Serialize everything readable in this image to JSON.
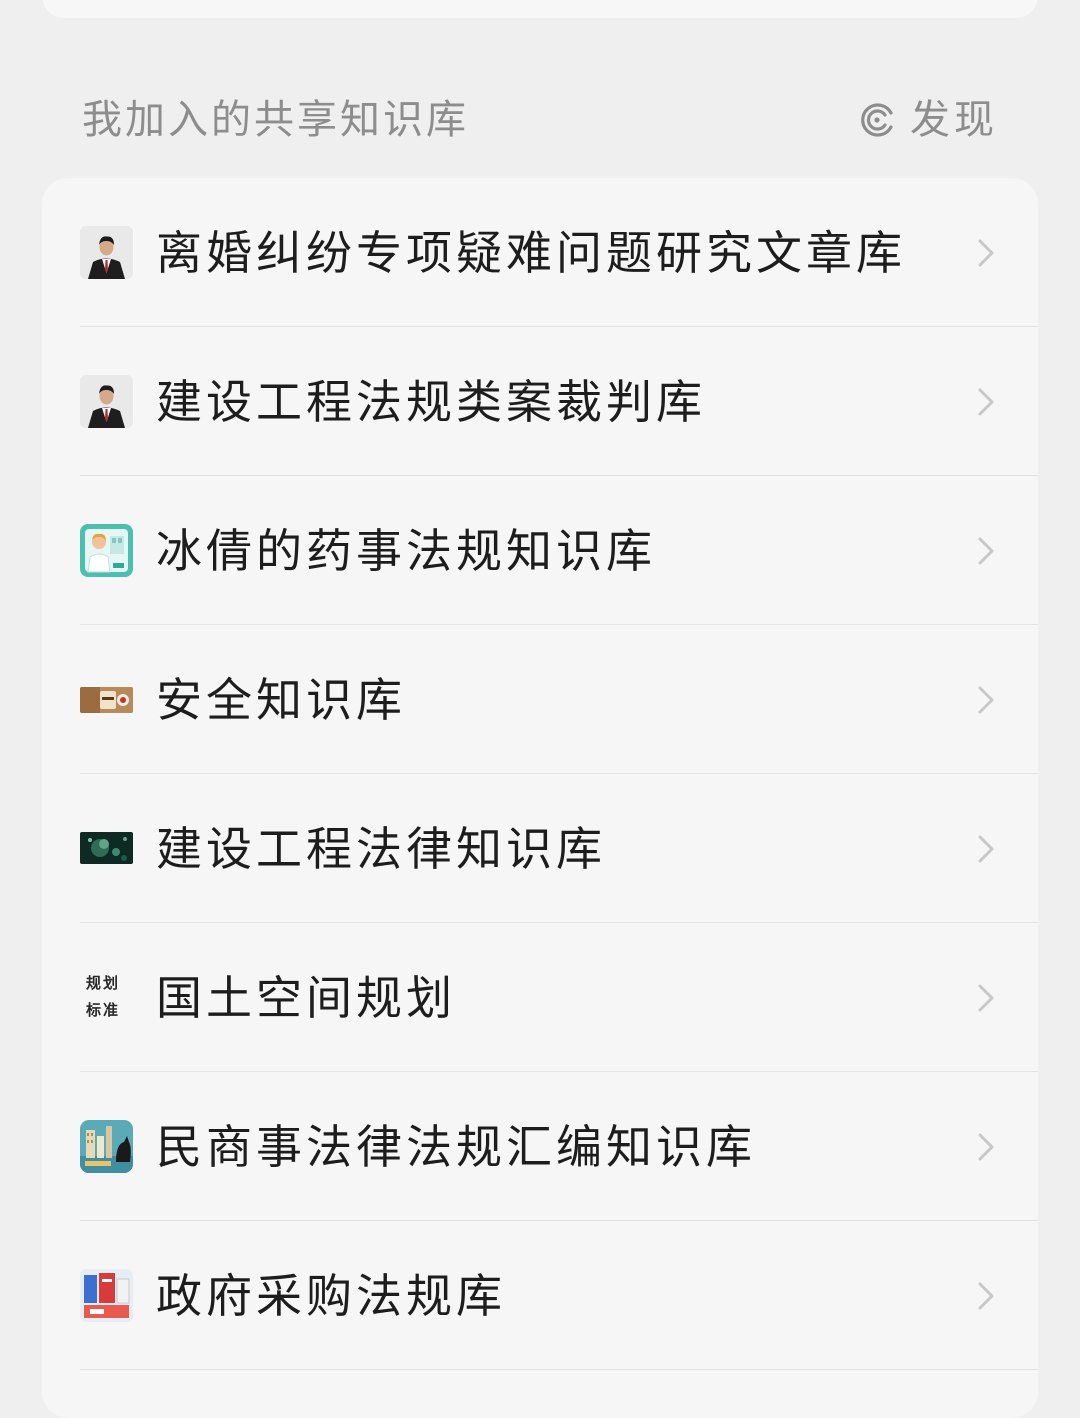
{
  "section": {
    "title": "我加入的共享知识库",
    "discover_label": "发现"
  },
  "items": [
    {
      "label": "离婚纠纷专项疑难问题研究文章库",
      "icon": "lawyer-avatar-icon"
    },
    {
      "label": "建设工程法规类案裁判库",
      "icon": "lawyer-avatar-icon"
    },
    {
      "label": "冰倩的药事法规知识库",
      "icon": "pharmacist-icon"
    },
    {
      "label": "安全知识库",
      "icon": "safety-photo-icon"
    },
    {
      "label": "建设工程法律知识库",
      "icon": "green-texture-icon"
    },
    {
      "label": "国土空间规划",
      "icon": "calligraphy-icon"
    },
    {
      "label": "民商事法律法规汇编知识库",
      "icon": "city-scene-icon"
    },
    {
      "label": "政府采购法规库",
      "icon": "office-supplies-icon"
    }
  ],
  "icon_text": {
    "calligraphy_line1": "规划",
    "calligraphy_line2": "标准"
  },
  "colors": {
    "page_background": "#efefef",
    "card_background": "#f6f6f6",
    "primary_text": "#1d1d1d",
    "secondary_text": "#8d8d8d",
    "chevron": "#c8c8c8",
    "divider": "#e4e4e4"
  }
}
